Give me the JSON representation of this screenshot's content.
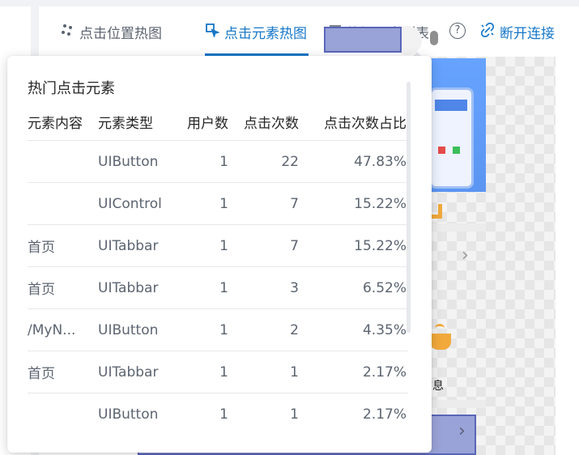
{
  "tabs": [
    {
      "label": "点击位置热图",
      "icon": "scatter-dots-icon",
      "active": false
    },
    {
      "label": "点击元素热图",
      "icon": "element-select-icon",
      "active": true
    },
    {
      "label": "热门元素列表",
      "icon": "list-icon",
      "active": false
    }
  ],
  "disconnect": {
    "label": "断开连接",
    "icon": "unlink-icon"
  },
  "help": {
    "icon": "help-circle-icon",
    "glyph": "?"
  },
  "popup": {
    "title": "热门点击元素",
    "columns": [
      "元素内容",
      "元素类型",
      "用户数",
      "点击次数",
      "点击次数占比"
    ],
    "rows": [
      {
        "content": "",
        "type": "UIButton",
        "users": "1",
        "clicks": "22",
        "ratio": "47.83%"
      },
      {
        "content": "",
        "type": "UIControl",
        "users": "1",
        "clicks": "7",
        "ratio": "15.22%"
      },
      {
        "content": "首页",
        "type": "UITabbar",
        "users": "1",
        "clicks": "7",
        "ratio": "15.22%"
      },
      {
        "content": "首页",
        "type": "UITabbar",
        "users": "1",
        "clicks": "3",
        "ratio": "6.52%"
      },
      {
        "content": "/MyN...",
        "type": "UIButton",
        "users": "1",
        "clicks": "2",
        "ratio": "4.35%"
      },
      {
        "content": "首页",
        "type": "UITabbar",
        "users": "1",
        "clicks": "1",
        "ratio": "2.17%"
      },
      {
        "content": "",
        "type": "UIButton",
        "users": "1",
        "clicks": "1",
        "ratio": "2.17%"
      }
    ]
  },
  "preview": {
    "partial_label": "信息",
    "partial_yellow_glyph": "业"
  },
  "colors": {
    "accent": "#1677c8",
    "highlight_fill": "#9aa3d8",
    "highlight_border": "#5966b8"
  }
}
